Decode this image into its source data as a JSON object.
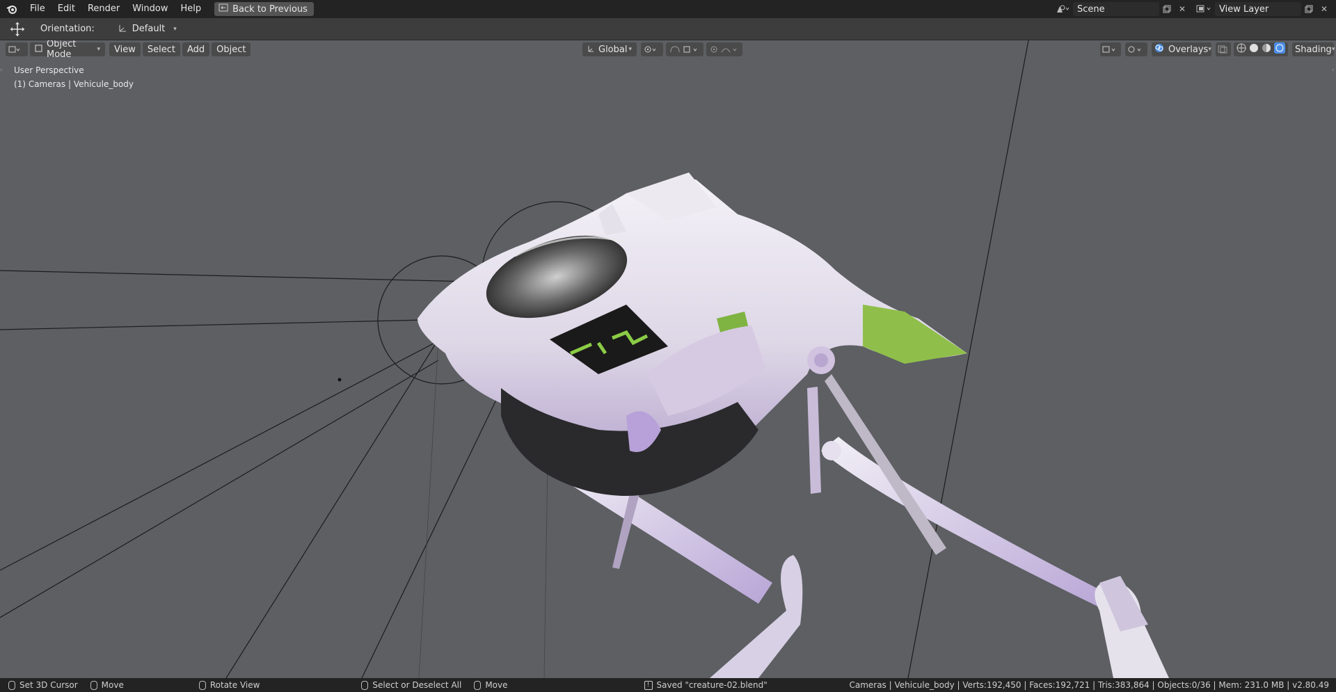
{
  "menu": {
    "file": "File",
    "edit": "Edit",
    "render": "Render",
    "window": "Window",
    "help": "Help",
    "back_to_previous": "Back to Previous"
  },
  "top_right": {
    "scene": "Scene",
    "view_layer": "View Layer"
  },
  "tool_header": {
    "orientation_label": "Orientation:",
    "orientation_value": "Default"
  },
  "viewport_header": {
    "mode": "Object Mode",
    "view": "View",
    "select": "Select",
    "add": "Add",
    "object": "Object",
    "transform_orientation": "Global",
    "overlays": "Overlays",
    "shading": "Shading"
  },
  "viewport": {
    "perspective": "User Perspective",
    "collection": "(1) Cameras | Vehicule_body"
  },
  "status": {
    "set_cursor": "Set 3D Cursor",
    "move1": "Move",
    "rotate_view": "Rotate View",
    "select_all": "Select or Deselect All",
    "move2": "Move",
    "saved": "Saved \"creature-02.blend\"",
    "stats": "Cameras | Vehicule_body | Verts:192,450 | Faces:192,721 | Tris:383,864 | Objects:0/36 | Mem: 231.0 MB | v2.80.49"
  }
}
